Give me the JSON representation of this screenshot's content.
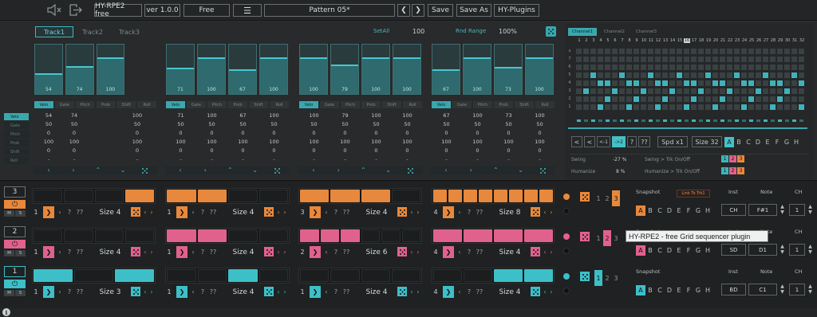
{
  "topbar": {
    "title": "HY-RPE2 free",
    "version": "ver 1.0.0",
    "edition": "Free",
    "pattern": "Pattern 05*",
    "save": "Save",
    "save_as": "Save As",
    "plugins": "HY-Plugins"
  },
  "tracks": {
    "tabs": [
      "Track1",
      "Track2",
      "Track3"
    ],
    "setall_label": "SetAll",
    "setall_value": "100",
    "rnd_label": "Rnd Range",
    "rnd_value": "100%"
  },
  "param_rows": [
    "Velo",
    "Gate",
    "Pitch",
    "Prob",
    "Shift",
    "Roll"
  ],
  "groups": [
    {
      "bars": [
        54,
        74,
        100
      ],
      "rows": [
        [
          "54",
          "74",
          "100"
        ],
        [
          "50",
          "50",
          "50"
        ],
        [
          "0",
          "0",
          "0"
        ],
        [
          "100",
          "100",
          "100"
        ],
        [
          "0",
          "0",
          "0"
        ],
        [
          "-",
          "-",
          "-"
        ]
      ]
    },
    {
      "bars": [
        71,
        100,
        67,
        100
      ],
      "rows": [
        [
          "71",
          "100",
          "67",
          "100"
        ],
        [
          "50",
          "50",
          "50",
          "50"
        ],
        [
          "0",
          "0",
          "0",
          "0"
        ],
        [
          "100",
          "100",
          "100",
          "100"
        ],
        [
          "0",
          "0",
          "0",
          "0"
        ],
        [
          "-",
          "-",
          "-",
          "-"
        ]
      ]
    },
    {
      "bars": [
        100,
        79,
        100,
        100
      ],
      "rows": [
        [
          "100",
          "79",
          "100",
          "100"
        ],
        [
          "50",
          "50",
          "50",
          "50"
        ],
        [
          "0",
          "0",
          "0",
          "0"
        ],
        [
          "100",
          "100",
          "100",
          "100"
        ],
        [
          "0",
          "0",
          "0",
          "0"
        ],
        [
          "-",
          "-",
          "-",
          "-"
        ]
      ]
    },
    {
      "bars": [
        67,
        100,
        73,
        100
      ],
      "rows": [
        [
          "67",
          "100",
          "73",
          "100"
        ],
        [
          "50",
          "50",
          "50",
          "50"
        ],
        [
          "0",
          "0",
          "0",
          "0"
        ],
        [
          "100",
          "100",
          "100",
          "100"
        ],
        [
          "0",
          "0",
          "0",
          "0"
        ],
        [
          "-",
          "-",
          "-",
          "-"
        ]
      ]
    }
  ],
  "channels": {
    "tabs": [
      "Channel1",
      "Channel2",
      "Channel3"
    ],
    "col_numbers": [
      "1",
      "2",
      "3",
      "4",
      "5",
      "6",
      "7",
      "8",
      "9",
      "10",
      "11",
      "12",
      "13",
      "14",
      "15",
      "16",
      "17",
      "18",
      "19",
      "20",
      "21",
      "22",
      "23",
      "24",
      "25",
      "26",
      "27",
      "28",
      "29",
      "30",
      "31",
      "32"
    ],
    "row_labels": [
      "x",
      "7",
      "6",
      "5",
      "4",
      "3",
      "2",
      "1"
    ],
    "highlight_col": "16"
  },
  "grid_controls": {
    "back": "<",
    "prev": "<",
    "rev1": "<-1",
    "fwd2": "->2",
    "q1": "?",
    "q2": "??",
    "speed": "Spd x1",
    "size": "Size 32",
    "letters": [
      "A",
      "B",
      "C",
      "D",
      "E",
      "F",
      "G",
      "H"
    ]
  },
  "swing": {
    "label": "Swing",
    "value": "-27 %",
    "onoff_label": "Swing > Trk On/Off",
    "tracks": [
      "1",
      "2",
      "3"
    ]
  },
  "humanize": {
    "label": "Humanize",
    "value": "8 %",
    "onoff_label": "Humanize > Trk On/Off",
    "tracks": [
      "1",
      "2",
      "3"
    ]
  },
  "lanes": [
    {
      "num": "3",
      "color": "#e8883c",
      "groups": [
        {
          "idx": "1",
          "q": "??",
          "size": "Size 4"
        },
        {
          "idx": "1",
          "q": "??",
          "size": "Size 4"
        },
        {
          "idx": "3",
          "q": "??",
          "size": "Size 4"
        },
        {
          "idx": "4",
          "q": "??",
          "size": "Size 8"
        }
      ],
      "inst": "CH",
      "note": "F#1",
      "ch": "1",
      "snap_nums": [
        "1",
        "2",
        "3"
      ]
    },
    {
      "num": "2",
      "color": "#e0628c",
      "groups": [
        {
          "idx": "1",
          "q": "??",
          "size": "Size 4"
        },
        {
          "idx": "1",
          "q": "??",
          "size": "Size 4"
        },
        {
          "idx": "2",
          "q": "??",
          "size": "Size 6"
        },
        {
          "idx": "4",
          "q": "??",
          "size": "Size 4"
        }
      ],
      "inst": "SD",
      "note": "D1",
      "ch": "1",
      "snap_nums": [
        "1",
        "2",
        "3"
      ]
    },
    {
      "num": "1",
      "color": "#3dbfc8",
      "groups": [
        {
          "idx": "1",
          "q": "??",
          "size": "Size 3"
        },
        {
          "idx": "1",
          "q": "??",
          "size": "Size 4"
        },
        {
          "idx": "1",
          "q": "??",
          "size": "Size 4"
        },
        {
          "idx": "4",
          "q": "??",
          "size": "Size 4"
        }
      ],
      "inst": "BD",
      "note": "C1",
      "ch": "1",
      "snap_nums": [
        "1",
        "2",
        "3"
      ]
    }
  ],
  "snapshot": {
    "label": "Snapshot",
    "link_label": "Link To Trk1",
    "letters": [
      "A",
      "B",
      "C",
      "D",
      "E",
      "F",
      "G",
      "H"
    ]
  },
  "lane_headers": {
    "inst": "Inst",
    "note": "Note",
    "ch": "CH"
  },
  "mini_labels": {
    "m": "M",
    "s": "S"
  },
  "tooltip": "HY-RPE2 - free Grid sequencer plugin",
  "info_icon": "i"
}
